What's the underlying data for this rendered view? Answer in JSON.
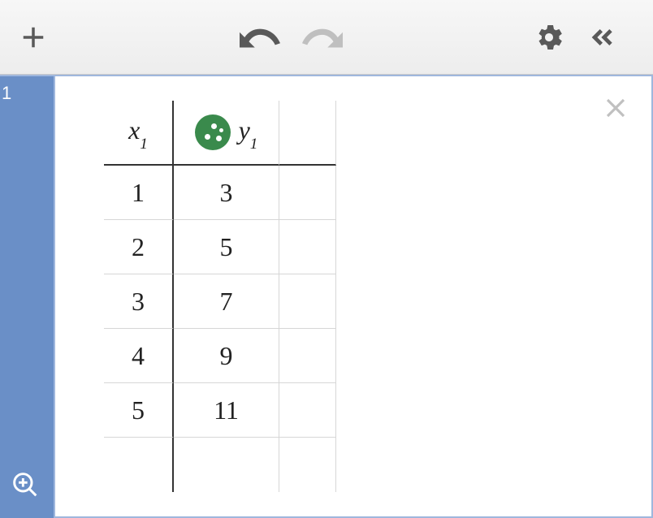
{
  "toolbar": {
    "add": "+",
    "undo": "undo",
    "redo": "redo",
    "settings": "settings",
    "collapse": "collapse"
  },
  "sidebar": {
    "row_number": "1"
  },
  "table": {
    "headers": {
      "x": "x",
      "x_sub": "1",
      "y": "y",
      "y_sub": "1"
    },
    "rows": [
      {
        "x": "1",
        "y": "3"
      },
      {
        "x": "2",
        "y": "5"
      },
      {
        "x": "3",
        "y": "7"
      },
      {
        "x": "4",
        "y": "9"
      },
      {
        "x": "5",
        "y": "11"
      }
    ]
  },
  "chart_data": {
    "type": "table",
    "series": [
      {
        "name": "x1",
        "values": [
          1,
          2,
          3,
          4,
          5
        ]
      },
      {
        "name": "y1",
        "values": [
          3,
          5,
          7,
          9,
          11
        ]
      }
    ]
  }
}
